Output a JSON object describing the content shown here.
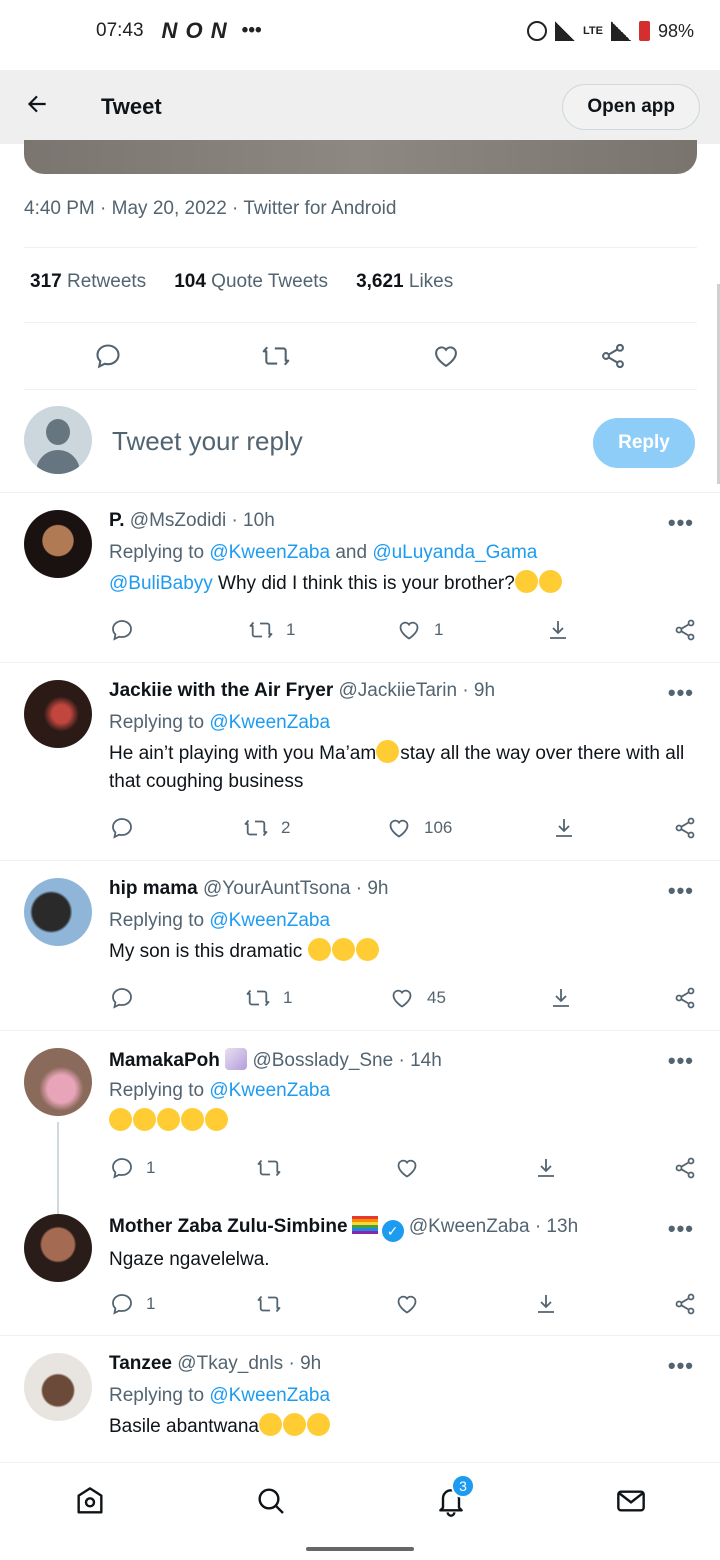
{
  "status_bar": {
    "time": "07:43",
    "notif_icons": "N O N",
    "more": "•••",
    "network": "LTE",
    "battery": "98%"
  },
  "header": {
    "title": "Tweet",
    "open_app": "Open app"
  },
  "main_tweet": {
    "meta": "4:40 PM · May 20, 2022 · Twitter for Android",
    "retweets_count": "317",
    "retweets_label": "Retweets",
    "quotes_count": "104",
    "quotes_label": "Quote Tweets",
    "likes_count": "3,621",
    "likes_label": "Likes"
  },
  "reply_box": {
    "placeholder": "Tweet your reply",
    "button": "Reply"
  },
  "replies": [
    {
      "name": "P.",
      "handle": "@MsZodidi",
      "time": "· 10h",
      "replying_prefix": "Replying to ",
      "replying_to": "@KweenZaba",
      "replying_and": " and ",
      "replying_to2": "@uLuyanda_Gama",
      "mention": "@BuliBabyy",
      "text": " Why did I think this is your brother?",
      "retweets": "1",
      "likes": "1"
    },
    {
      "name": "Jackiie with the Air Fryer",
      "handle": "@JackiieTarin",
      "time": "· 9h",
      "replying_prefix": "Replying to ",
      "replying_to": "@KweenZaba",
      "text_a": "He ain’t playing with you Ma’am",
      "text_b": "stay all the way over there with all that coughing business",
      "retweets": "2",
      "likes": "106"
    },
    {
      "name": "hip mama",
      "handle": "@YourAuntTsona",
      "time": "· 9h",
      "replying_prefix": "Replying to ",
      "replying_to": "@KweenZaba",
      "text": "My son is this dramatic ",
      "retweets": "1",
      "likes": "45"
    },
    {
      "name": "MamakaPoh",
      "handle": "@Bosslady_Sne",
      "time": "· 14h",
      "replying_prefix": "Replying to ",
      "replying_to": "@KweenZaba",
      "replies": "1"
    },
    {
      "name": "Mother Zaba Zulu-Simbine",
      "handle": "@KweenZaba",
      "time": "· 13h",
      "text": "Ngaze ngavelelwa.",
      "replies": "1"
    },
    {
      "name": "Tanzee",
      "handle": "@Tkay_dnls",
      "time": "· 9h",
      "replying_prefix": "Replying to ",
      "replying_to": "@KweenZaba",
      "text": "Basile abantwana"
    }
  ],
  "bottom_nav": {
    "notifications_badge": "3"
  },
  "icons": [
    "back-arrow-icon",
    "reply-icon",
    "retweet-icon",
    "like-icon",
    "share-icon",
    "more-icon",
    "download-icon",
    "home-icon",
    "search-icon",
    "notifications-icon",
    "messages-icon"
  ],
  "colors": {
    "accent": "#1d9bf0",
    "secondary_text": "#536471",
    "reply_button_disabled": "#8ecdf7"
  }
}
